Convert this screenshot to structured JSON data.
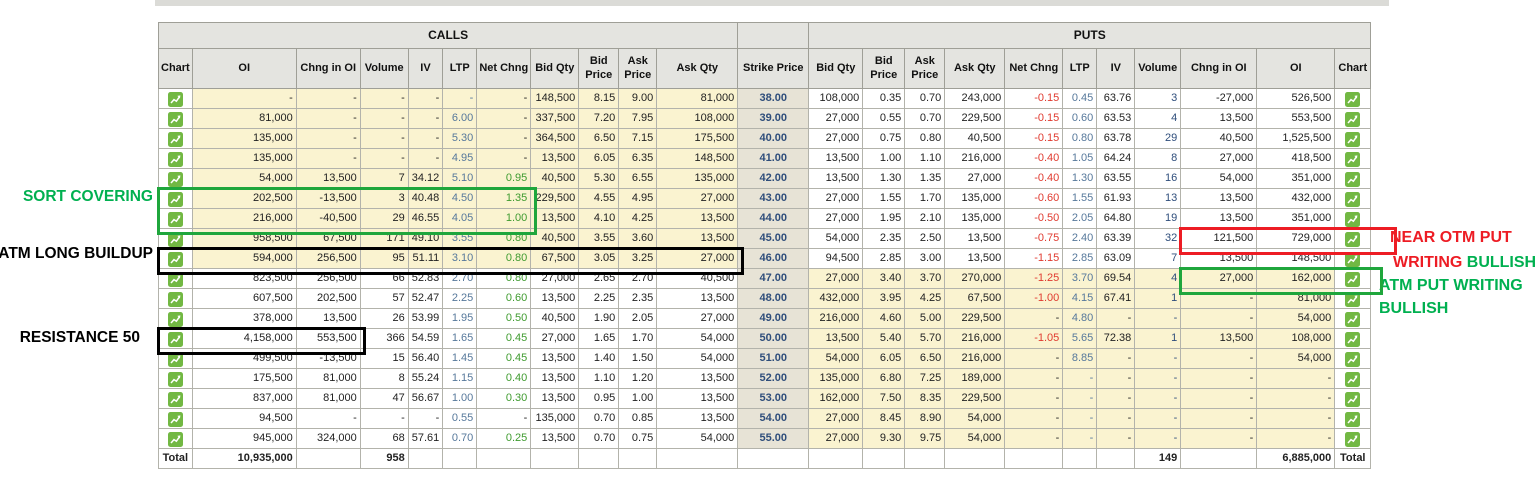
{
  "table": {
    "calls_header": "CALLS",
    "puts_header": "PUTS",
    "strike_header": "Strike Price",
    "calls_columns": [
      "Chart",
      "OI",
      "Chng in OI",
      "Volume",
      "IV",
      "LTP",
      "Net Chng",
      "Bid Qty",
      "Bid Price",
      "Ask Price",
      "Ask Qty"
    ],
    "puts_columns": [
      "Bid Qty",
      "Bid Price",
      "Ask Price",
      "Ask Qty",
      "Net Chng",
      "LTP",
      "IV",
      "Volume",
      "Chng in OI",
      "OI",
      "Chart"
    ],
    "chart_icon": "chart-icon",
    "rows": [
      {
        "strike": "38.00",
        "calls": [
          "-",
          "-",
          "-",
          "-",
          "-",
          "-",
          "148,500",
          "8.15",
          "9.00",
          "81,000"
        ],
        "puts": [
          "108,000",
          "0.35",
          "0.70",
          "243,000",
          "-0.15",
          "0.45",
          "63.76",
          "3",
          "-27,000",
          "526,500"
        ]
      },
      {
        "strike": "39.00",
        "calls": [
          "81,000",
          "-",
          "-",
          "-",
          "6.00",
          "-",
          "337,500",
          "7.20",
          "7.95",
          "108,000"
        ],
        "puts": [
          "27,000",
          "0.55",
          "0.70",
          "229,500",
          "-0.15",
          "0.60",
          "63.53",
          "4",
          "13,500",
          "553,500"
        ]
      },
      {
        "strike": "40.00",
        "calls": [
          "135,000",
          "-",
          "-",
          "-",
          "5.30",
          "-",
          "364,500",
          "6.50",
          "7.15",
          "175,500"
        ],
        "puts": [
          "27,000",
          "0.75",
          "0.80",
          "40,500",
          "-0.15",
          "0.80",
          "63.78",
          "29",
          "40,500",
          "1,525,500"
        ]
      },
      {
        "strike": "41.00",
        "calls": [
          "135,000",
          "-",
          "-",
          "-",
          "4.95",
          "-",
          "13,500",
          "6.05",
          "6.35",
          "148,500"
        ],
        "puts": [
          "13,500",
          "1.00",
          "1.10",
          "216,000",
          "-0.40",
          "1.05",
          "64.24",
          "8",
          "27,000",
          "418,500"
        ]
      },
      {
        "strike": "42.00",
        "calls": [
          "54,000",
          "13,500",
          "7",
          "34.12",
          "5.10",
          "0.95",
          "40,500",
          "5.30",
          "6.55",
          "135,000"
        ],
        "puts": [
          "13,500",
          "1.30",
          "1.35",
          "27,000",
          "-0.40",
          "1.30",
          "63.55",
          "16",
          "54,000",
          "351,000"
        ]
      },
      {
        "strike": "43.00",
        "calls": [
          "202,500",
          "-13,500",
          "3",
          "40.48",
          "4.50",
          "1.35",
          "229,500",
          "4.55",
          "4.95",
          "27,000"
        ],
        "puts": [
          "27,000",
          "1.55",
          "1.70",
          "135,000",
          "-0.60",
          "1.55",
          "61.93",
          "13",
          "13,500",
          "432,000"
        ]
      },
      {
        "strike": "44.00",
        "calls": [
          "216,000",
          "-40,500",
          "29",
          "46.55",
          "4.05",
          "1.00",
          "13,500",
          "4.10",
          "4.25",
          "13,500"
        ],
        "puts": [
          "27,000",
          "1.95",
          "2.10",
          "135,000",
          "-0.50",
          "2.05",
          "64.80",
          "19",
          "13,500",
          "351,000"
        ]
      },
      {
        "strike": "45.00",
        "calls": [
          "958,500",
          "67,500",
          "171",
          "49.10",
          "3.55",
          "0.80",
          "40,500",
          "3.55",
          "3.60",
          "13,500"
        ],
        "puts": [
          "54,000",
          "2.35",
          "2.50",
          "13,500",
          "-0.75",
          "2.40",
          "63.39",
          "32",
          "121,500",
          "729,000"
        ]
      },
      {
        "strike": "46.00",
        "calls": [
          "594,000",
          "256,500",
          "95",
          "51.11",
          "3.10",
          "0.80",
          "67,500",
          "3.05",
          "3.25",
          "27,000"
        ],
        "puts": [
          "94,500",
          "2.85",
          "3.00",
          "13,500",
          "-1.15",
          "2.85",
          "63.09",
          "7",
          "13,500",
          "148,500"
        ]
      },
      {
        "strike": "47.00",
        "calls": [
          "823,500",
          "256,500",
          "66",
          "52.83",
          "2.70",
          "0.80",
          "27,000",
          "2.65",
          "2.70",
          "40,500"
        ],
        "puts": [
          "27,000",
          "3.40",
          "3.70",
          "270,000",
          "-1.25",
          "3.70",
          "69.54",
          "4",
          "27,000",
          "162,000"
        ]
      },
      {
        "strike": "48.00",
        "calls": [
          "607,500",
          "202,500",
          "57",
          "52.47",
          "2.25",
          "0.60",
          "13,500",
          "2.25",
          "2.35",
          "13,500"
        ],
        "puts": [
          "432,000",
          "3.95",
          "4.25",
          "67,500",
          "-1.00",
          "4.15",
          "67.41",
          "1",
          "-",
          "81,000"
        ]
      },
      {
        "strike": "49.00",
        "calls": [
          "378,000",
          "13,500",
          "26",
          "53.99",
          "1.95",
          "0.50",
          "40,500",
          "1.90",
          "2.05",
          "27,000"
        ],
        "puts": [
          "216,000",
          "4.60",
          "5.00",
          "229,500",
          "-",
          "4.80",
          "-",
          "-",
          "-",
          "54,000"
        ]
      },
      {
        "strike": "50.00",
        "calls": [
          "4,158,000",
          "553,500",
          "366",
          "54.59",
          "1.65",
          "0.45",
          "27,000",
          "1.65",
          "1.70",
          "54,000"
        ],
        "puts": [
          "13,500",
          "5.40",
          "5.70",
          "216,000",
          "-1.05",
          "5.65",
          "72.38",
          "1",
          "13,500",
          "108,000"
        ]
      },
      {
        "strike": "51.00",
        "calls": [
          "499,500",
          "-13,500",
          "15",
          "56.40",
          "1.45",
          "0.45",
          "13,500",
          "1.40",
          "1.50",
          "54,000"
        ],
        "puts": [
          "54,000",
          "6.05",
          "6.50",
          "216,000",
          "-",
          "8.85",
          "-",
          "-",
          "-",
          "54,000"
        ]
      },
      {
        "strike": "52.00",
        "calls": [
          "175,500",
          "81,000",
          "8",
          "55.24",
          "1.15",
          "0.40",
          "13,500",
          "1.10",
          "1.20",
          "13,500"
        ],
        "puts": [
          "135,000",
          "6.80",
          "7.25",
          "189,000",
          "-",
          "-",
          "-",
          "-",
          "-",
          "-"
        ]
      },
      {
        "strike": "53.00",
        "calls": [
          "837,000",
          "81,000",
          "47",
          "56.67",
          "1.00",
          "0.30",
          "13,500",
          "0.95",
          "1.00",
          "13,500"
        ],
        "puts": [
          "162,000",
          "7.50",
          "8.35",
          "229,500",
          "-",
          "-",
          "-",
          "-",
          "-",
          "-"
        ]
      },
      {
        "strike": "54.00",
        "calls": [
          "94,500",
          "-",
          "-",
          "-",
          "0.55",
          "-",
          "135,000",
          "0.70",
          "0.85",
          "13,500"
        ],
        "puts": [
          "27,000",
          "8.45",
          "8.90",
          "54,000",
          "-",
          "-",
          "-",
          "-",
          "-",
          "-"
        ]
      },
      {
        "strike": "55.00",
        "calls": [
          "945,000",
          "324,000",
          "68",
          "57.61",
          "0.70",
          "0.25",
          "13,500",
          "0.70",
          "0.75",
          "54,000"
        ],
        "puts": [
          "27,000",
          "9.30",
          "9.75",
          "54,000",
          "-",
          "-",
          "-",
          "-",
          "-",
          "-"
        ]
      }
    ],
    "totals": {
      "label": "Total",
      "calls_oi": "10,935,000",
      "calls_volume": "958",
      "puts_volume": "149",
      "puts_oi": "6,885,000"
    }
  },
  "annotations": {
    "sort_covering": {
      "text": "SORT COVERING",
      "color": "#00b050"
    },
    "atm_long_buildup": {
      "text": "ATM LONG BUILDUP",
      "color": "#000000"
    },
    "resistance_50": {
      "text": "RESISTANCE 50",
      "color": "#000000"
    },
    "near_otm": {
      "line1": [
        {
          "text": "NEAR OTM PUT",
          "color": "#ed1c24"
        }
      ],
      "line2": [
        {
          "text": "WRITING ",
          "color": "#ed1c24"
        },
        {
          "text": "BULLISH",
          "color": "#00b050"
        }
      ]
    },
    "atm_put": {
      "line1": [
        {
          "text": "ATM PUT WRITING",
          "color": "#00b050"
        }
      ],
      "line2": [
        {
          "text": "BULLISH",
          "color": "#00b050"
        }
      ]
    }
  },
  "highlight_boxes": [
    {
      "id": "sort-covering-highlight-box",
      "color": "#1fa63c",
      "side": "calls",
      "row_start": "43.00",
      "row_end": "44.00",
      "col_start": 0,
      "col_end": 6,
      "extend_right": 0
    },
    {
      "id": "atm-long-buildup-highlight-box",
      "color": "#000000",
      "side": "calls",
      "row_start": "46.00",
      "row_end": "46.00",
      "col_start": 0,
      "col_end": 10,
      "extend_right": 0
    },
    {
      "id": "resistance-50-highlight-box",
      "color": "#000000",
      "side": "calls",
      "row_start": "50.00",
      "row_end": "50.00",
      "col_start": 0,
      "col_end": 2,
      "extend_right": 0
    },
    {
      "id": "near-otm-put-writing-highlight-box",
      "color": "#ed1c24",
      "side": "puts",
      "row_start": "45.00",
      "row_end": "45.00",
      "col_start": 8,
      "col_end": 10,
      "extend_right": 20
    },
    {
      "id": "atm-put-writing-highlight-box",
      "color": "#1fa63c",
      "side": "puts",
      "row_start": "47.00",
      "row_end": "47.00",
      "col_start": 8,
      "col_end": 10,
      "extend_right": 6
    }
  ],
  "colors": {
    "itm_cell_bg": "#faf3d0",
    "header_bg": "#e4e4e0",
    "strike_bg": "#e7e3d6",
    "strike_text": "#2e4d7b",
    "ltp_text": "#56789b",
    "net_chng_pos": "#3f9b2f",
    "net_chng_neg": "#e03a2f",
    "chart_icon_green": "#72b843",
    "annotation_green": "#00b050",
    "annotation_red": "#ed1c24"
  }
}
